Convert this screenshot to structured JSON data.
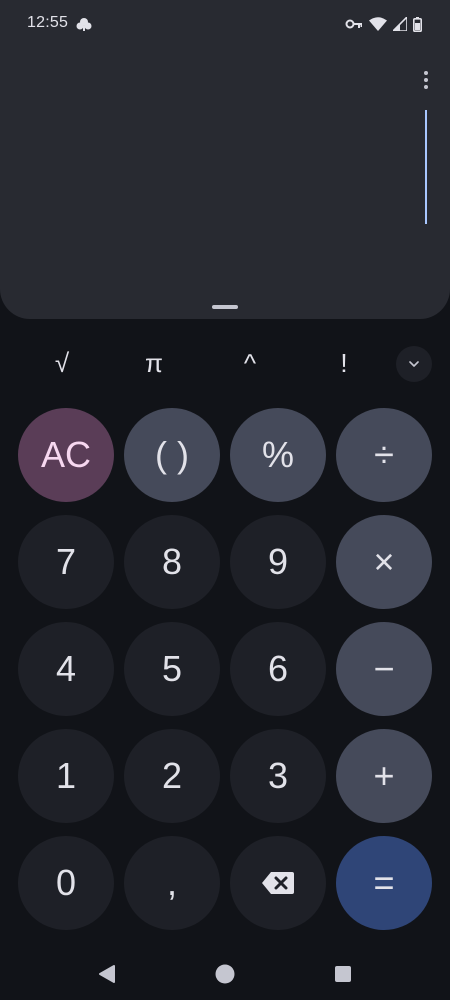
{
  "status_bar": {
    "time": "12:55",
    "icons": [
      "cloud-icon",
      "vpn-key-icon",
      "wifi-icon",
      "signal-icon",
      "battery-icon"
    ]
  },
  "display": {
    "expression": "",
    "result": ""
  },
  "scientific_row": {
    "sqrt": "√",
    "pi": "π",
    "power": "^",
    "factorial": "!"
  },
  "keypad": {
    "clear": "AC",
    "parens": "( )",
    "percent": "%",
    "divide": "÷",
    "seven": "7",
    "eight": "8",
    "nine": "9",
    "multiply": "×",
    "four": "4",
    "five": "5",
    "six": "6",
    "minus": "−",
    "one": "1",
    "two": "2",
    "three": "3",
    "plus": "+",
    "zero": "0",
    "decimal": ",",
    "equals": "="
  },
  "colors": {
    "background": "#111318",
    "display_panel": "#282a31",
    "number_key": "#1e2027",
    "operator_key": "#454a5a",
    "clear_key": "#5a3d57",
    "equals_key": "#2f4577",
    "cursor": "#a9c7ff"
  }
}
